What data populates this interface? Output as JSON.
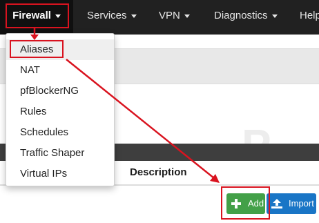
{
  "navbar": {
    "items": [
      {
        "label": "Firewall",
        "has_caret": true
      },
      {
        "label": "Services",
        "has_caret": true
      },
      {
        "label": "VPN",
        "has_caret": true
      },
      {
        "label": "Diagnostics",
        "has_caret": true
      },
      {
        "label": "Help",
        "has_caret": false
      }
    ],
    "background": "#212121",
    "active_background": "#101010"
  },
  "firewall_menu": {
    "items": [
      {
        "label": "Aliases",
        "active": true
      },
      {
        "label": "NAT"
      },
      {
        "label": "pfBlockerNG"
      },
      {
        "label": "Rules"
      },
      {
        "label": "Schedules"
      },
      {
        "label": "Traffic Shaper"
      },
      {
        "label": "Virtual IPs"
      }
    ]
  },
  "table": {
    "header_description": "Description"
  },
  "actions": {
    "add_label": "Add",
    "add_icon": "plus-icon",
    "add_color": "#43a048",
    "import_label": "Import",
    "import_icon": "upload-icon",
    "import_color": "#1975c6"
  },
  "annotations": {
    "highlight_color": "#d9131f",
    "highlighted": [
      "Firewall",
      "Aliases",
      "Add"
    ]
  }
}
